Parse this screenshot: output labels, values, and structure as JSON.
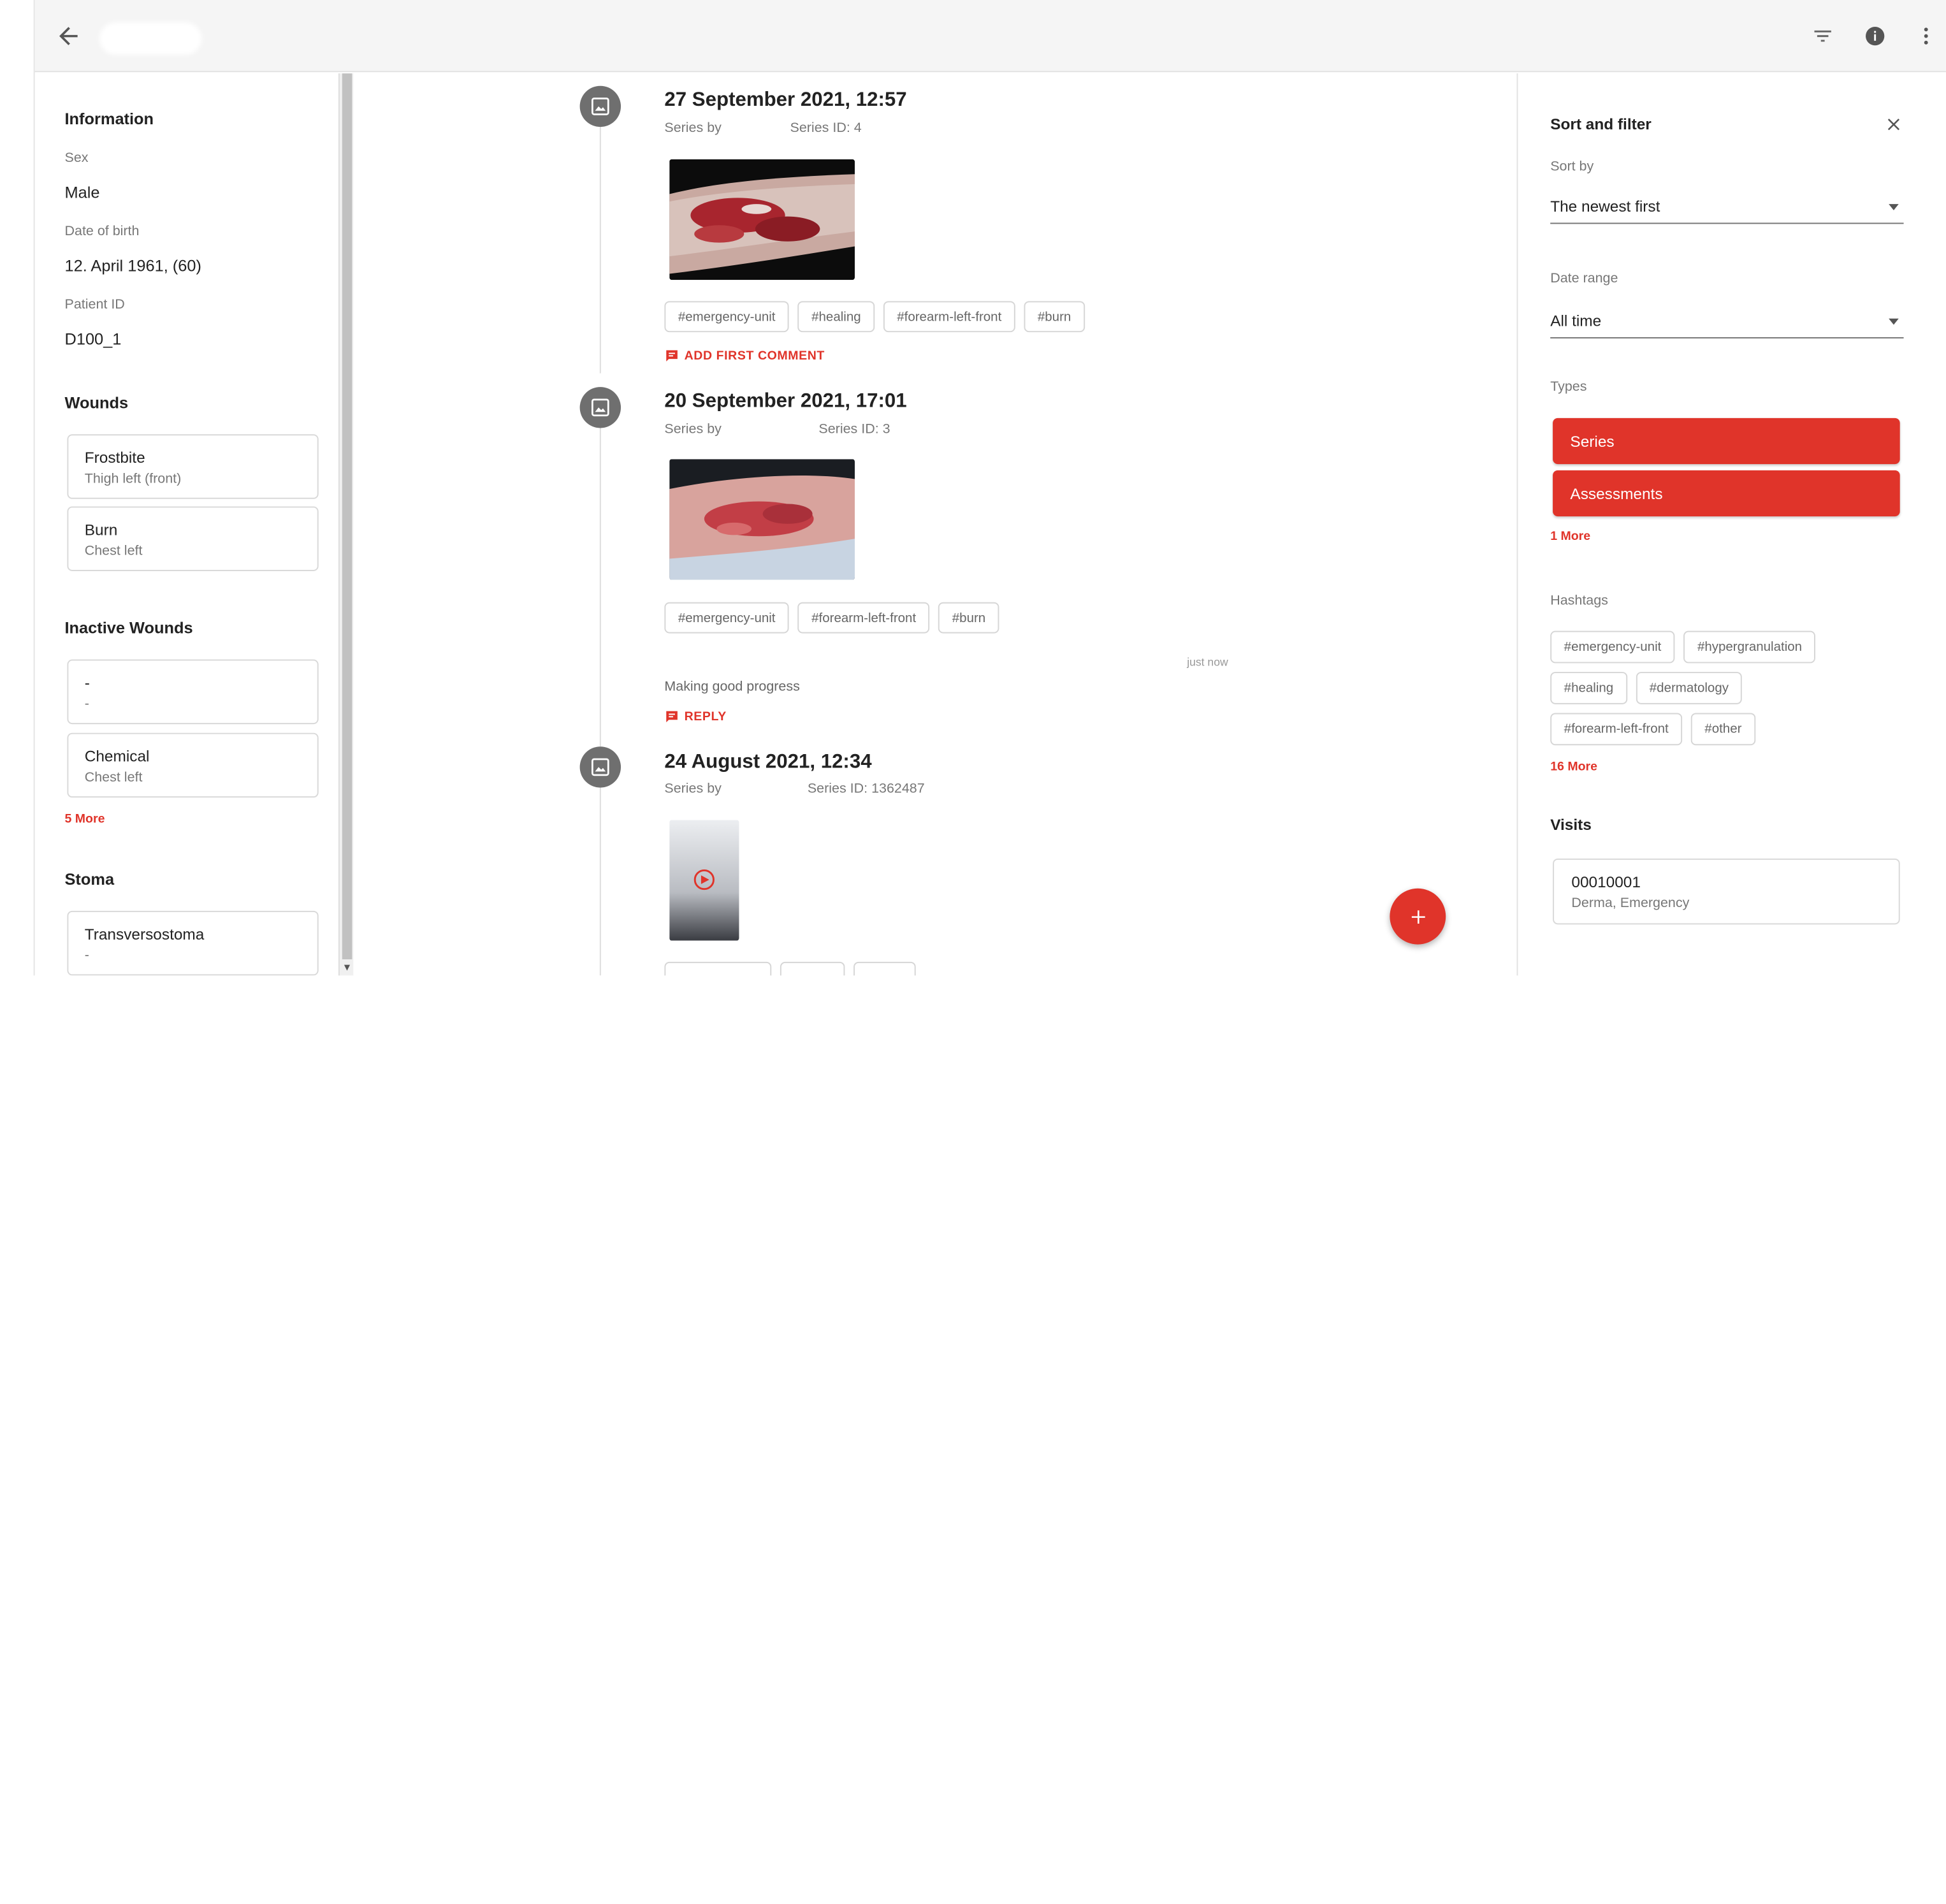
{
  "topbar": {
    "back_icon": "arrow-left-icon",
    "icons": [
      "filter-icon",
      "info-icon",
      "more-vert-icon"
    ]
  },
  "patient": {
    "info_title": "Information",
    "sex_label": "Sex",
    "sex_value": "Male",
    "dob_label": "Date of birth",
    "dob_value": "12. April 1961, (60)",
    "pid_label": "Patient ID",
    "pid_value": "D100_1",
    "wounds_title": "Wounds",
    "wounds": [
      {
        "name": "Frostbite",
        "location": "Thigh left (front)"
      },
      {
        "name": "Burn",
        "location": "Chest left"
      }
    ],
    "inactive_title": "Inactive Wounds",
    "inactive_wounds": [
      {
        "name": "-",
        "location": "-"
      },
      {
        "name": "Chemical",
        "location": "Chest left"
      }
    ],
    "inactive_more": "5 More",
    "stoma_title": "Stoma",
    "stoma": [
      {
        "name": "Transversostoma",
        "location": "-"
      }
    ]
  },
  "feed": {
    "entries": [
      {
        "date": "27 September 2021, 12:57",
        "series_by": "Series by",
        "series_id": "Series ID: 4",
        "tags": [
          "#emergency-unit",
          "#healing",
          "#forearm-left-front",
          "#burn"
        ],
        "action": "ADD FIRST COMMENT"
      },
      {
        "date": "20 September 2021, 17:01",
        "series_by": "Series by",
        "series_id": "Series ID: 3",
        "tags": [
          "#emergency-unit",
          "#forearm-left-front",
          "#burn"
        ],
        "comment_time": "just now",
        "comment": "Making good progress",
        "action": "REPLY"
      },
      {
        "date": "24 August 2021, 12:34",
        "series_by": "Series by",
        "series_id": "Series ID: 1362487"
      }
    ],
    "fab_icon": "plus-icon",
    "accent": "#e0342a"
  },
  "filter": {
    "title": "Sort and filter",
    "sort_label": "Sort by",
    "sort_value": "The newest first",
    "range_label": "Date range",
    "range_value": "All time",
    "types_label": "Types",
    "types": [
      "Series",
      "Assessments"
    ],
    "types_more": "1 More",
    "hashtags_label": "Hashtags",
    "hashtags": [
      [
        "#emergency-unit",
        "#hypergranulation"
      ],
      [
        "#healing",
        "#dermatology"
      ],
      [
        "#forearm-left-front",
        "#other"
      ]
    ],
    "hashtags_more": "16 More",
    "visits_title": "Visits",
    "visit": {
      "id": "00010001",
      "dept": "Derma, Emergency"
    }
  }
}
